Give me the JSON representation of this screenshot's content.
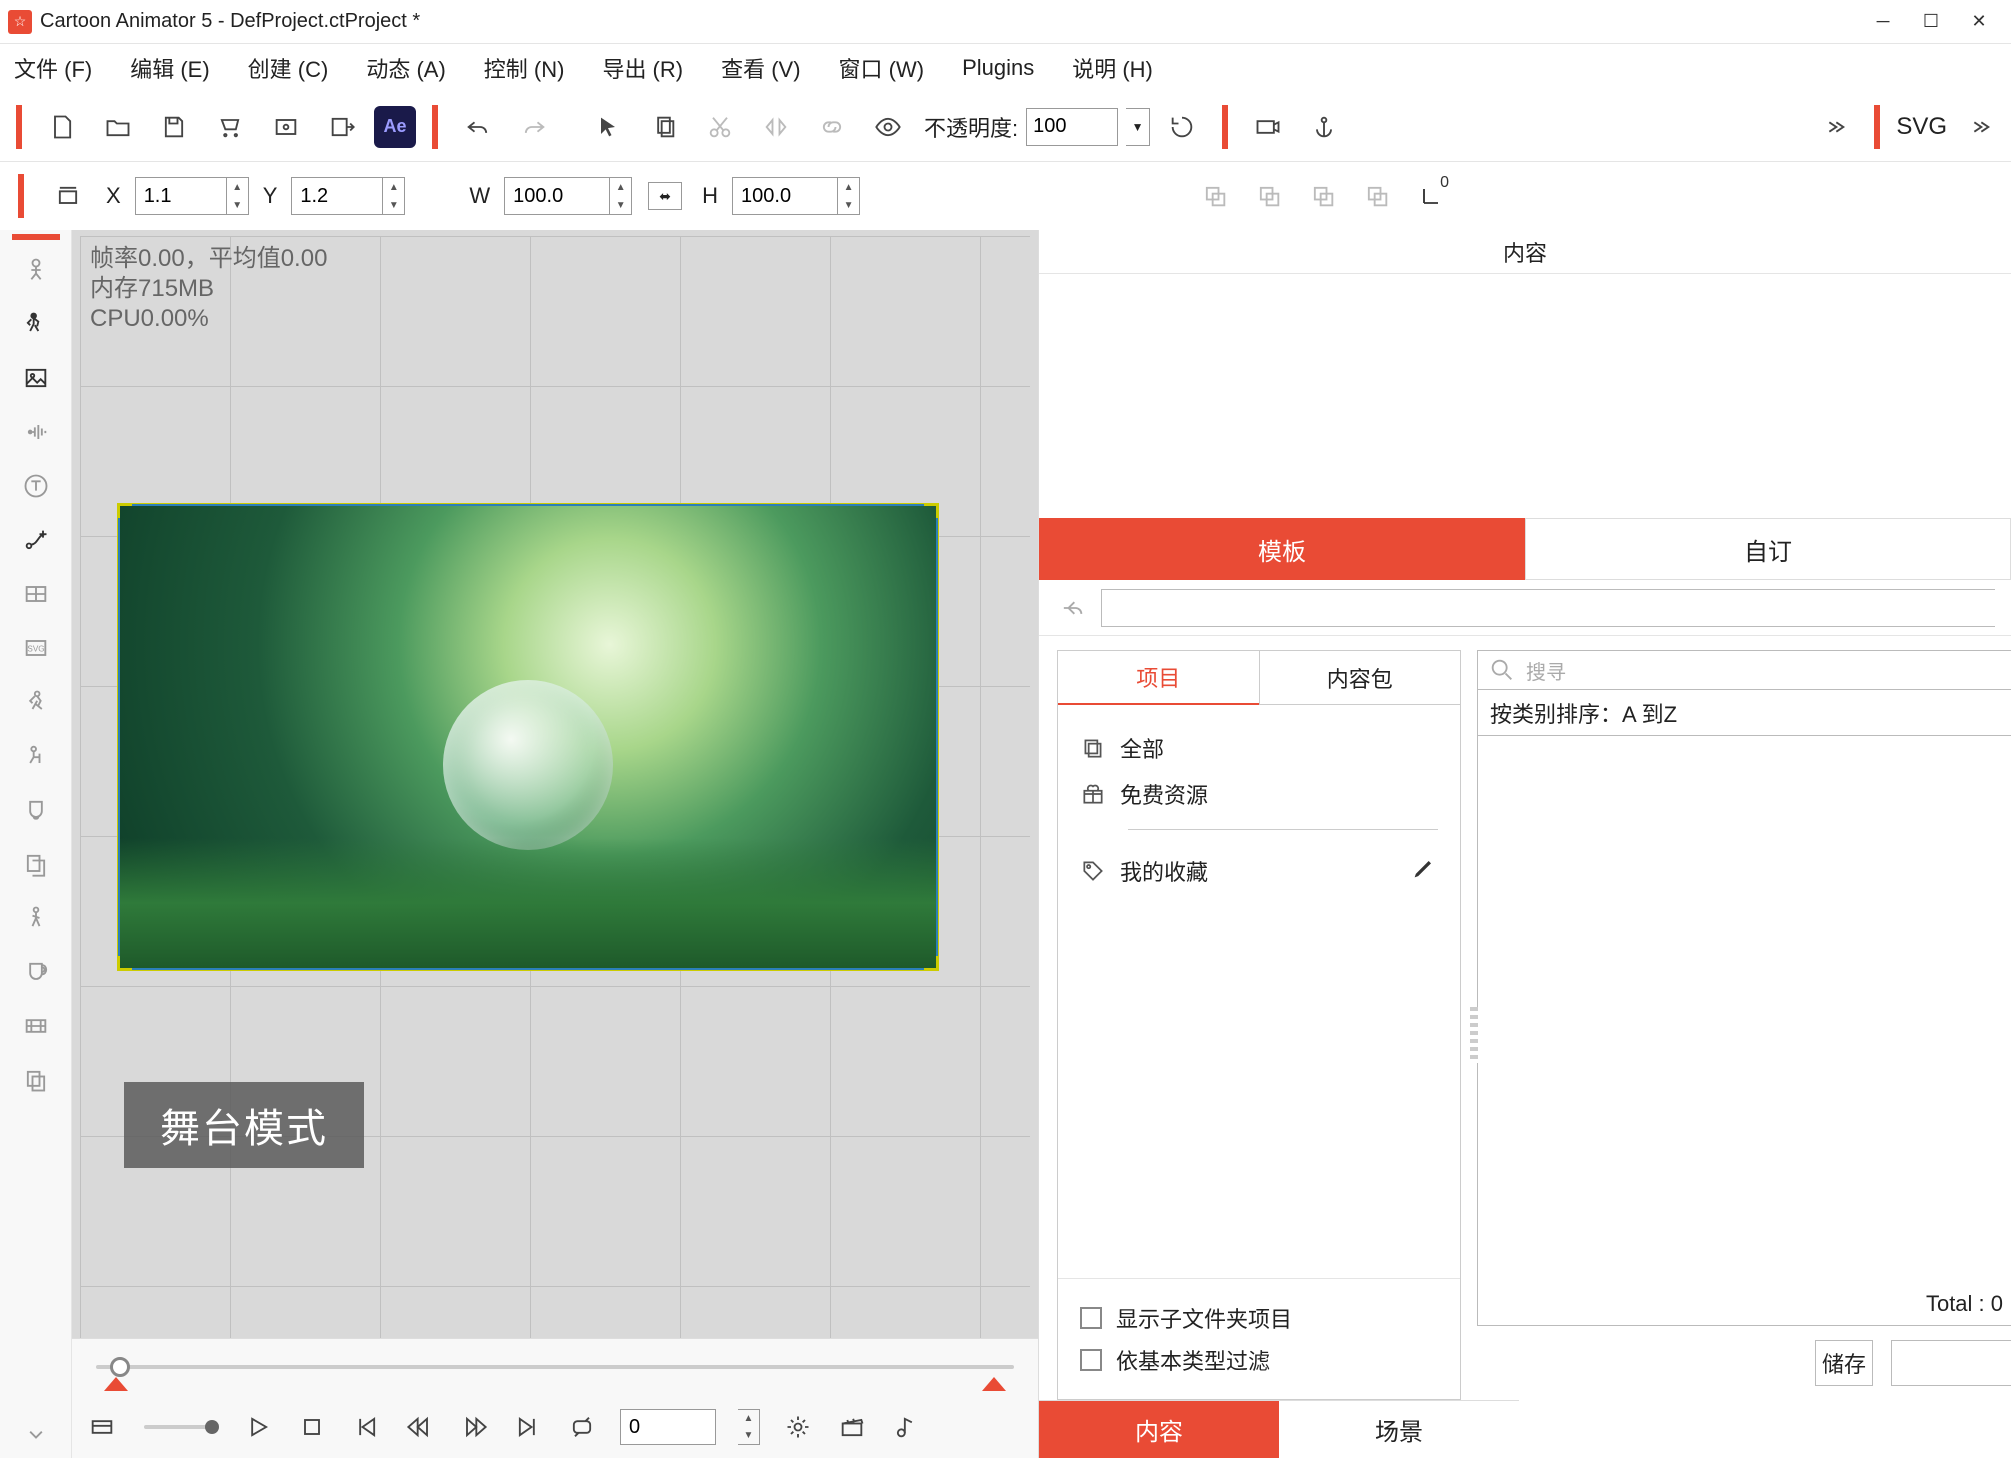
{
  "title_bar": {
    "title": "Cartoon Animator 5 - DefProject.ctProject *"
  },
  "menu": {
    "file": "文件 (F)",
    "edit": "编辑 (E)",
    "create": "创建 (C)",
    "dynamic": "动态 (A)",
    "control": "控制 (N)",
    "export": "导出 (R)",
    "view": "查看 (V)",
    "window": "窗口 (W)",
    "plugins": "Plugins",
    "help": "说明 (H)"
  },
  "toolbar": {
    "ae": "Ae",
    "opacity_label": "不透明度:",
    "opacity_value": "100",
    "svg_label": "SVG"
  },
  "coords": {
    "x_label": "X",
    "x_value": "1.1",
    "y_label": "Y",
    "y_value": "1.2",
    "w_label": "W",
    "w_value": "100.0",
    "h_label": "H",
    "h_value": "100.0",
    "align_origin": "0"
  },
  "stage": {
    "stats_line1": "帧率0.00，平均值0.00",
    "stats_line2": "内存715MB",
    "stats_line3": "CPU0.00%",
    "mode_badge": "舞台模式"
  },
  "timeline": {
    "frame_value": "0"
  },
  "right_panel": {
    "title": "内容",
    "tab_template": "模板",
    "tab_custom": "自订",
    "subtab_project": "项目",
    "subtab_pack": "内容包",
    "tree_all": "全部",
    "tree_free": "免费资源",
    "tree_favorite": "我的收藏",
    "check_showsub": "显示子文件夹项目",
    "check_filterbase": "依基本类型过滤",
    "search_placeholder": "搜寻",
    "sort_label": "按类别排序：A 到Z",
    "total_label": "Total : 0",
    "save_button": "储存"
  },
  "bottom_tabs": {
    "content": "内容",
    "scene": "场景"
  }
}
